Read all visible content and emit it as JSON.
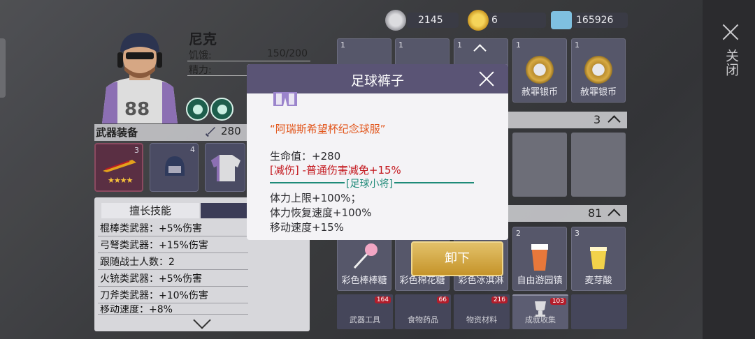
{
  "character": {
    "name": "尼克",
    "stats": [
      {
        "label": "饥饿:",
        "value": "150/200"
      },
      {
        "label": "精力:",
        "value": ""
      }
    ]
  },
  "weapons": {
    "title": "武器装备",
    "power": "280",
    "slots": [
      {
        "level": "3",
        "stars": "★★★★"
      },
      {
        "level": "4"
      },
      {
        "level": ""
      }
    ]
  },
  "skills": {
    "tab_label": "擅长技能",
    "rows": [
      "棍棒类武器：+5%伤害",
      "弓弩类武器：+15%伤害",
      "跟随战士人数：2",
      "火铳类武器：+5%伤害",
      "刀斧类武器：+10%伤害",
      "移动速度：+8%"
    ]
  },
  "currencies": [
    {
      "name": "silver",
      "value": "2145",
      "color": "#b9b9bd"
    },
    {
      "name": "gold-smile",
      "value": "6",
      "color": "#e7b93a"
    },
    {
      "name": "cash",
      "value": "165926",
      "color": "#6bb0d8"
    }
  ],
  "inventory_top": [
    {
      "count": "1",
      "name": ""
    },
    {
      "count": "1",
      "name": ""
    },
    {
      "count": "1",
      "name": ""
    },
    {
      "count": "1",
      "name": "赦罪银币"
    },
    {
      "count": "1",
      "name": "赦罪银币"
    }
  ],
  "section_a_count": "3",
  "section_b_count": "81",
  "inventory_bottom": [
    {
      "count": "",
      "name": "彩色棒棒糖"
    },
    {
      "count": "",
      "name": "彩色棉花糖"
    },
    {
      "count": "",
      "name": "彩色冰淇淋"
    },
    {
      "count": "2",
      "name": "自由游园镇"
    },
    {
      "count": "3",
      "name": "麦芽酸"
    }
  ],
  "categories": [
    {
      "name": "武器工具",
      "count": "164"
    },
    {
      "name": "食物药品",
      "count": "66"
    },
    {
      "name": "物资材料",
      "count": "216"
    },
    {
      "name": "成就收集",
      "count": "103"
    }
  ],
  "close_label": "关闭",
  "dialog": {
    "title": "足球裤子",
    "subtitle": "“阿瑞斯希望杯纪念球服”",
    "hp": "生命值：+280",
    "damage_reduction": "[减伤] -普通伤害减免+15%",
    "set_name": "[足球小将]",
    "bonus_lines": [
      "体力上限+100%；",
      "体力恢复速度+100%",
      "移动速度+15%"
    ]
  },
  "unequip_label": "卸下",
  "colors": {
    "dialog_header": "#5a5475",
    "subtitle_orange": "#e2551b",
    "red_text": "#c3161c",
    "set_green": "#1e8a78",
    "button_gold": "#c5942a"
  }
}
